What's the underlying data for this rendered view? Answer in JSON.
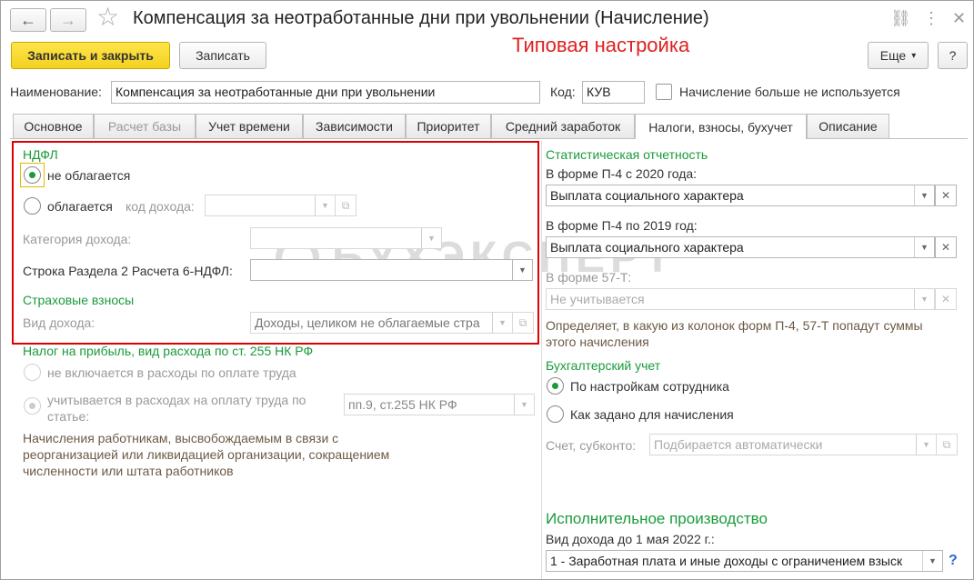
{
  "window": {
    "title": "Компенсация за неотработанные дни при увольнении (Начисление)",
    "banner": "Типовая настройка"
  },
  "toolbar": {
    "save_close": "Записать и закрыть",
    "save": "Записать",
    "more": "Еще",
    "more_arrow": "▾",
    "help": "?"
  },
  "header": {
    "name_label": "Наименование:",
    "name_value": "Компенсация за неотработанные дни при увольнении",
    "code_label": "Код:",
    "code_value": "КУВ",
    "not_used_label": "Начисление больше не используется"
  },
  "tabs": [
    {
      "label": "Основное"
    },
    {
      "label": "Расчет базы"
    },
    {
      "label": "Учет времени"
    },
    {
      "label": "Зависимости"
    },
    {
      "label": "Приоритет"
    },
    {
      "label": "Средний заработок"
    },
    {
      "label": "Налоги, взносы, бухучет"
    },
    {
      "label": "Описание"
    }
  ],
  "ndfl": {
    "heading": "НДФЛ",
    "not_taxed": "не облагается",
    "taxed": "облагается",
    "income_code_label": "код дохода:",
    "income_category_label": "Категория дохода:",
    "section2_label": "Строка Раздела 2 Расчета 6-НДФЛ:"
  },
  "insurance": {
    "heading": "Страховые взносы",
    "income_type_label": "Вид дохода:",
    "income_type_value": "Доходы, целиком не облагаемые стра"
  },
  "profit_tax": {
    "heading": "Налог на прибыль, вид расхода по ст. 255 НК РФ",
    "option1": "не включается в расходы по оплате труда",
    "option2_line1": "учитывается в расходах на оплату труда по",
    "option2_line2": "статье:",
    "article_value": "пп.9, ст.255 НК РФ",
    "note_line1": "Начисления работникам, высвобождаемым в связи с",
    "note_line2": "реорганизацией или ликвидацией организации, сокращением",
    "note_line3": "численности или штата работников"
  },
  "stats": {
    "heading": "Статистическая отчетность",
    "p4_2020_label": "В форме П-4 с 2020 года:",
    "p4_2020_value": "Выплата социального характера",
    "p4_2019_label": "В форме П-4 по 2019 год:",
    "p4_2019_value": "Выплата социального характера",
    "f57_label": "В форме 57-Т:",
    "f57_value": "Не учитывается",
    "note_line1": "Определяет, в какую из колонок форм П-4, 57-Т попадут суммы",
    "note_line2": "этого начисления"
  },
  "accounting": {
    "heading": "Бухгалтерский учет",
    "option1": "По настройкам сотрудника",
    "option2": "Как задано для начисления",
    "account_label": "Счет, субконто:",
    "account_value": "Подбирается автоматически"
  },
  "enforcement": {
    "heading": "Исполнительное производство",
    "label": "Вид дохода до 1 мая 2022 г.:",
    "value": "1 - Заработная плата и иные доходы с ограничением взыск",
    "help": "?"
  },
  "watermark": "БУХЭКСПЕРТ",
  "icons": {
    "back": "←",
    "forward": "→",
    "star": "☆",
    "link": "⛓",
    "menu": "⋮",
    "close": "✕",
    "dropdown": "▼",
    "open": "⧉",
    "clear": "✕"
  }
}
